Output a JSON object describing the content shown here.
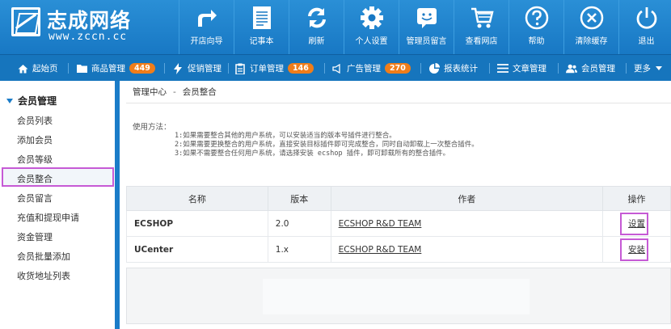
{
  "brand": {
    "title": "志成网络",
    "subtitle": "www.zccn.cc"
  },
  "top_nav": [
    {
      "label": "开店向导",
      "icon": "share-arrow-icon"
    },
    {
      "label": "记事本",
      "icon": "notepad-icon"
    },
    {
      "label": "刷新",
      "icon": "refresh-icon"
    },
    {
      "label": "个人设置",
      "icon": "gear-icon"
    },
    {
      "label": "管理员留言",
      "icon": "chat-smile-icon"
    },
    {
      "label": "查看网店",
      "icon": "cart-icon"
    },
    {
      "label": "帮助",
      "icon": "help-icon"
    },
    {
      "label": "清除缓存",
      "icon": "clear-x-icon"
    },
    {
      "label": "退出",
      "icon": "power-icon"
    }
  ],
  "sub_nav": [
    {
      "label": "起始页",
      "icon": "home-icon",
      "badge": ""
    },
    {
      "label": "商品管理",
      "icon": "folder-icon",
      "badge": "449"
    },
    {
      "label": "促销管理",
      "icon": "bolt-icon",
      "badge": ""
    },
    {
      "label": "订单管理",
      "icon": "clipboard-icon",
      "badge": "146"
    },
    {
      "label": "广告管理",
      "icon": "speaker-icon",
      "badge": "270"
    },
    {
      "label": "报表统计",
      "icon": "pie-icon",
      "badge": ""
    },
    {
      "label": "文章管理",
      "icon": "list-icon",
      "badge": ""
    },
    {
      "label": "会员管理",
      "icon": "users-icon",
      "badge": ""
    },
    {
      "label": "更多",
      "icon": "caret-down-icon",
      "badge": ""
    }
  ],
  "sidebar": {
    "heading": "会员管理",
    "items": [
      "会员列表",
      "添加会员",
      "会员等级",
      "会员整合",
      "会员留言",
      "充值和提现申请",
      "资金管理",
      "会员批量添加",
      "收货地址列表"
    ],
    "active_index": 3
  },
  "breadcrumb": {
    "root": "管理中心",
    "sep": "-",
    "current": "会员整合"
  },
  "usage": {
    "title": "使用方法：",
    "lines": [
      "1:如果需要整合其他的用户系统，可以安装适当的版本号插件进行整合。",
      "2:如果需要更换整合的用户系统，直接安装目标插件即可完成整合，同时自动卸载上一次整合插件。",
      "3:如果不需要整合任何用户系统，请选择安装 ecshop 插件，即可卸载所有的整合插件。"
    ]
  },
  "table": {
    "headers": [
      "名称",
      "版本",
      "作者",
      "操作"
    ],
    "rows": [
      {
        "name": "ECSHOP",
        "version": "2.0",
        "author": "ECSHOP R&D TEAM",
        "action": "设置"
      },
      {
        "name": "UCenter",
        "version": "1.x",
        "author": "ECSHOP R&D TEAM",
        "action": "安装"
      }
    ]
  },
  "colors": {
    "header_blue": "#1878c4",
    "subnav_blue": "#1675bd",
    "badge_orange": "#f07d1a",
    "highlight": "#c65ad5"
  }
}
